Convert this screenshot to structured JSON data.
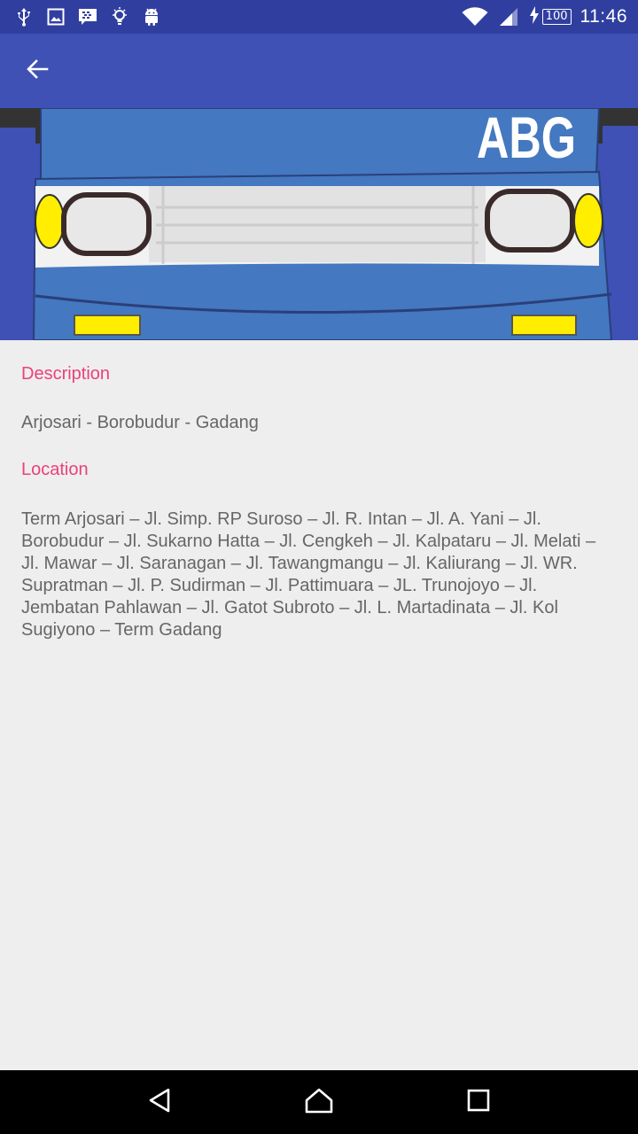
{
  "status_bar": {
    "icons": [
      "usb-icon",
      "image-icon",
      "bbm-icon",
      "lightbulb-icon",
      "android-icon",
      "wifi-icon",
      "signal-icon",
      "charging-icon"
    ],
    "battery": "100",
    "time": "11:46"
  },
  "app_bar": {
    "back_icon": "arrow-back-icon"
  },
  "hero": {
    "logo_text": "ABG",
    "colors": {
      "body": "#4478c0",
      "lights": "#ffee00",
      "grille": "#e0e0e0"
    }
  },
  "details": {
    "description_heading": "Description",
    "description_text": "Arjosari - Borobudur - Gadang",
    "location_heading": "Location",
    "location_text": "Term Arjosari – Jl. Simp. RP Suroso – Jl. R. Intan – Jl. A. Yani – Jl. Borobudur – Jl. Sukarno Hatta – Jl. Cengkeh – Jl. Kalpataru – Jl. Melati – Jl. Mawar – Jl. Saranagan – Jl. Tawangmangu – Jl. Kaliurang – Jl. WR. Supratman – Jl. P. Sudirman – Jl. Pattimuara – JL. Trunojoyo – Jl. Jembatan Pahlawan – Jl. Gatot Subroto – Jl. L. Martadinata – Jl. Kol Sugiyono – Term Gadang"
  },
  "colors": {
    "status_bar": "#303f9f",
    "app_bar": "#3f51b5",
    "accent": "#ec407a",
    "body_text": "#666666",
    "background": "#eeeeee"
  },
  "nav_bar": {
    "icons": [
      "back-triangle-icon",
      "home-icon",
      "recents-icon"
    ]
  }
}
